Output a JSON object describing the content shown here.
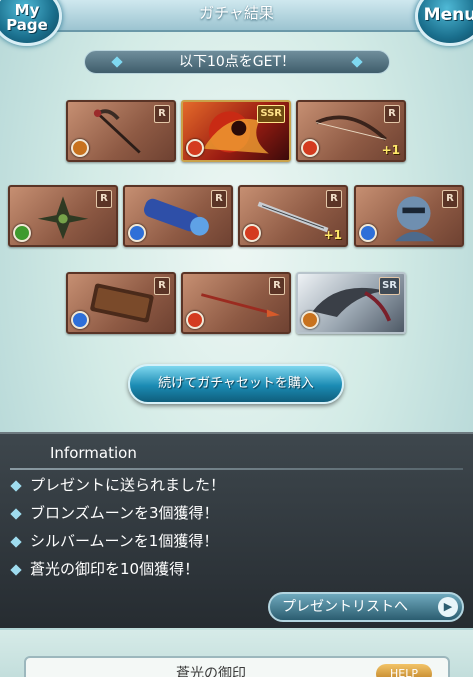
{
  "header": {
    "title": "ガチャ結果",
    "mypage_label": "My Page",
    "menu_label": "Menu"
  },
  "banner": {
    "text": "以下10点をGET！"
  },
  "items": [
    {
      "name": "scythe",
      "rarity": "R",
      "element": "wind",
      "plus": ""
    },
    {
      "name": "fire-summon",
      "rarity": "SSR",
      "element": "fire",
      "plus": ""
    },
    {
      "name": "bow",
      "rarity": "R",
      "element": "fire",
      "plus": "+1"
    },
    {
      "name": "shuriken",
      "rarity": "R",
      "element": "earth",
      "plus": ""
    },
    {
      "name": "gauntlet",
      "rarity": "R",
      "element": "water",
      "plus": ""
    },
    {
      "name": "sword",
      "rarity": "R",
      "element": "fire",
      "plus": "+1"
    },
    {
      "name": "knight-summon",
      "rarity": "R",
      "element": "water",
      "plus": ""
    },
    {
      "name": "tome",
      "rarity": "R",
      "element": "water",
      "plus": ""
    },
    {
      "name": "spear",
      "rarity": "R",
      "element": "fire",
      "plus": ""
    },
    {
      "name": "scythe-blade",
      "rarity": "SR",
      "element": "wind",
      "plus": ""
    }
  ],
  "buy_button": {
    "label": "続けてガチャセットを購入"
  },
  "info": {
    "title": "Information",
    "rows": [
      "プレゼントに送られました！",
      "ブロンズムーンを3個獲得！",
      "シルバームーンを1個獲得！",
      "蒼光の御印を10個獲得！"
    ],
    "present_button": "プレゼントリストへ"
  },
  "bottom": {
    "card_title": "蒼光の御印",
    "help_label": "HELP"
  },
  "colors": {
    "wind": "#c8721e",
    "fire": "#d43b1f",
    "earth": "#3f9a2e",
    "water": "#2e6fd8"
  }
}
